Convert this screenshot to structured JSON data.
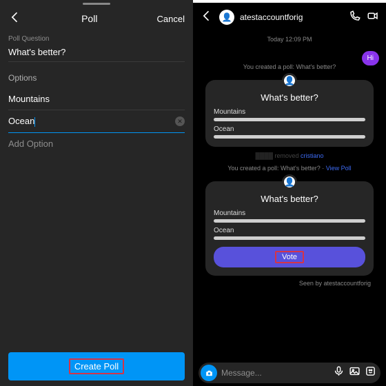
{
  "left": {
    "title": "Poll",
    "cancel": "Cancel",
    "question_label": "Poll Question",
    "question_value": "What's better?",
    "options_label": "Options",
    "option1": "Mountains",
    "option2": "Ocean",
    "add_option": "Add Option",
    "create_btn": "Create Poll"
  },
  "right": {
    "username": "atestaccountforig",
    "timestamp": "Today 12:09 PM",
    "hi_bubble": "Hi",
    "created_poll_text": "You created a poll: What's better?",
    "poll1": {
      "title": "What's better?",
      "option1": "Mountains",
      "option2": "Ocean"
    },
    "removed_text_dim": "removed",
    "removed_text_link": "cristiano",
    "created_poll_text2_prefix": "You created a poll: What's better? · ",
    "view_poll": "View Poll",
    "poll2": {
      "title": "What's better?",
      "option1": "Mountains",
      "option2": "Ocean",
      "vote_btn": "Vote"
    },
    "seen_by": "Seen by atestaccountforig",
    "composer_placeholder": "Message..."
  }
}
